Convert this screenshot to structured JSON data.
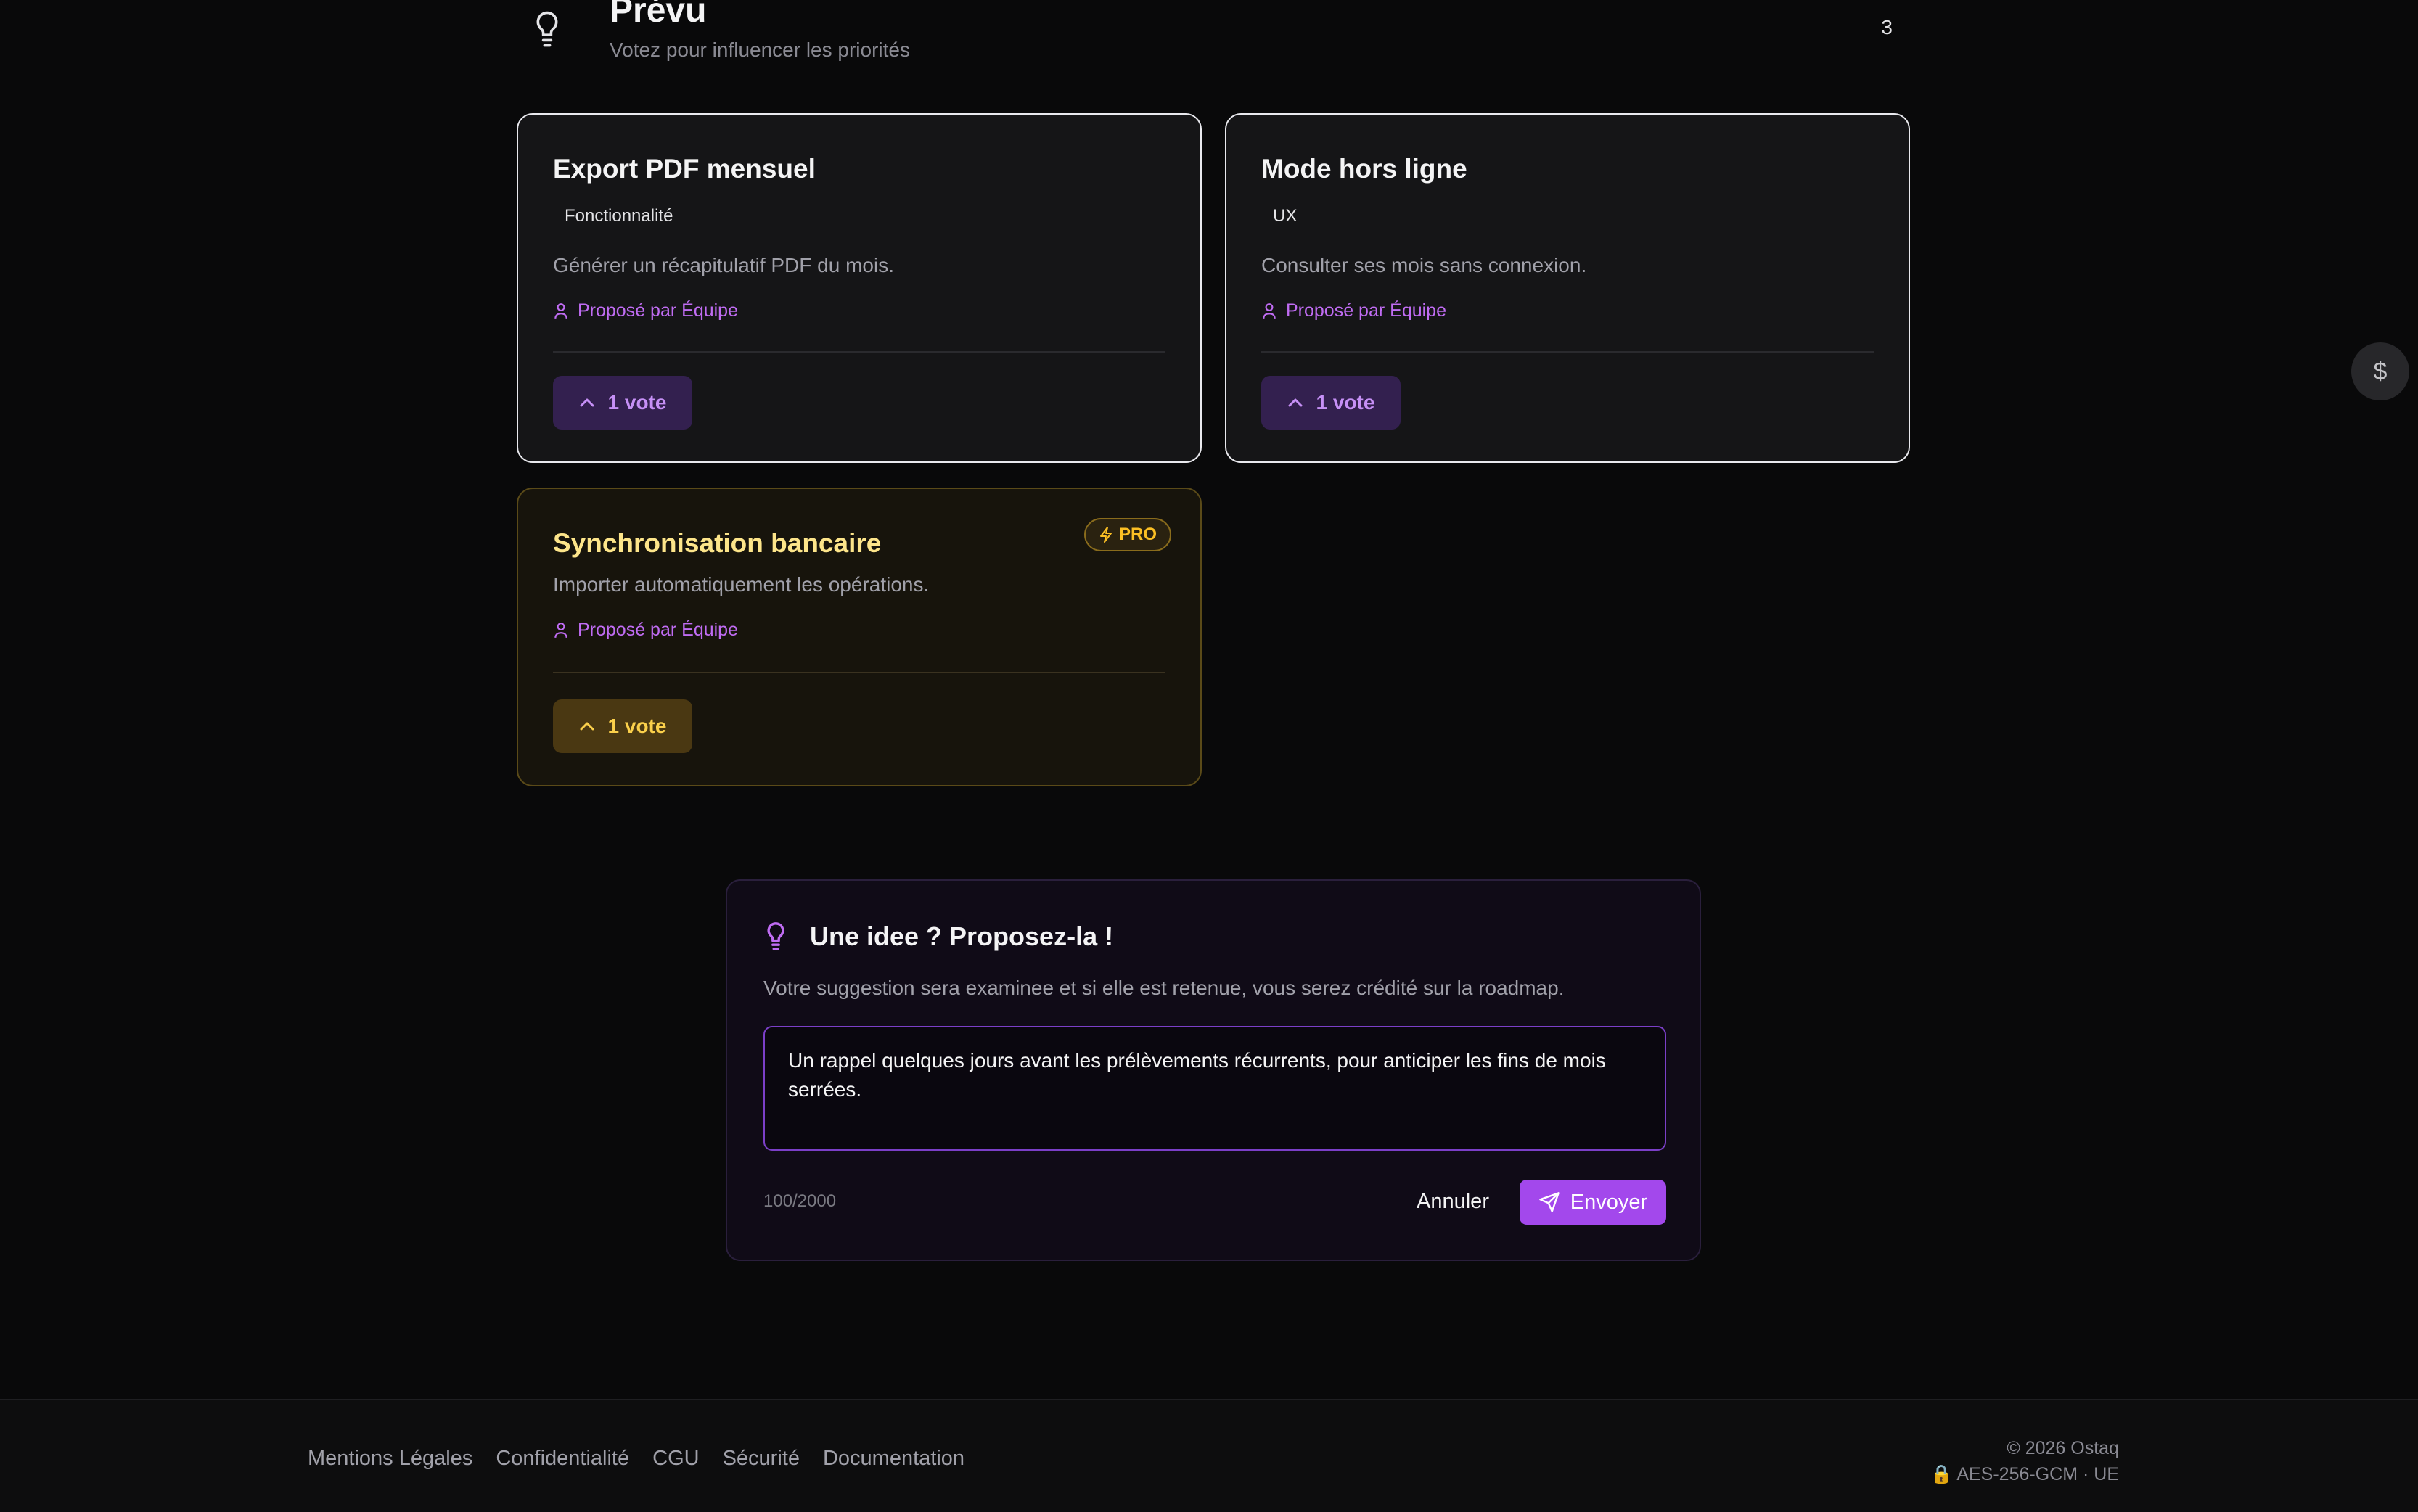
{
  "section": {
    "title": "Prévu",
    "subtitle": "Votez pour influencer les priorités",
    "count": "3"
  },
  "cards": [
    {
      "title": "Export PDF mensuel",
      "tag": "Fonctionnalité",
      "description": "Générer un récapitulatif PDF du mois.",
      "author": "Proposé par Équipe",
      "votes": "1 vote"
    },
    {
      "title": "Mode hors ligne",
      "tag": "UX",
      "description": "Consulter ses mois sans connexion.",
      "author": "Proposé par Équipe",
      "votes": "1 vote"
    },
    {
      "title": "Synchronisation bancaire",
      "badge": "PRO",
      "description": "Importer automatiquement les opérations.",
      "author": "Proposé par Équipe",
      "votes": "1 vote"
    }
  ],
  "side_button": {
    "symbol": "$"
  },
  "suggestion": {
    "title": "Une idee ? Proposez-la !",
    "description": "Votre suggestion sera examinee et si elle est retenue, vous serez crédité sur la roadmap.",
    "text": "Un rappel quelques jours avant les prélèvements récurrents, pour anticiper les fins de mois serrées.",
    "char_count": "100/2000",
    "cancel_label": "Annuler",
    "send_label": "Envoyer"
  },
  "footer": {
    "links": [
      "Mentions Légales",
      "Confidentialité",
      "CGU",
      "Sécurité",
      "Documentation"
    ],
    "copyright": "© 2026 Ostaq",
    "security": "🔒 AES-256-GCM · UE"
  },
  "colors": {
    "accent": "#a348ec",
    "author": "#c06cf3",
    "pro": "#fbbf24",
    "background": "#09090a"
  }
}
